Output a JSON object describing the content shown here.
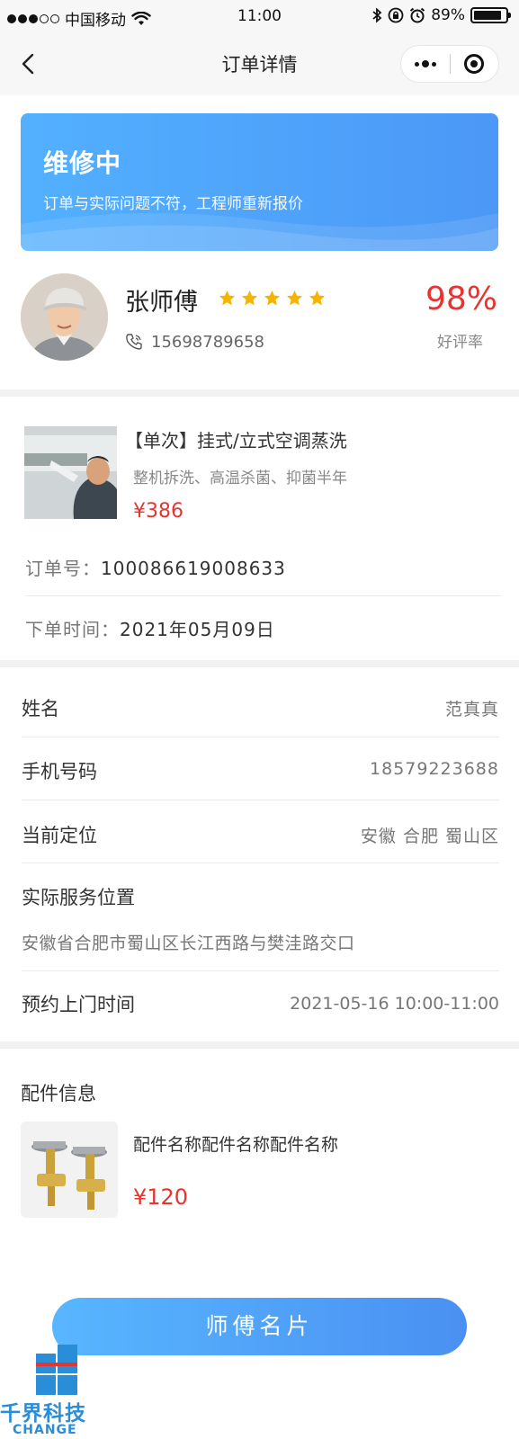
{
  "status_bar": {
    "carrier": "中国移动",
    "time": "11:00",
    "battery": "89%",
    "battery_level": 0.89
  },
  "nav": {
    "title": "订单详情",
    "back_icon": "chevron-left-icon",
    "more_icon": "more-dots-icon",
    "close_icon": "target-close-icon"
  },
  "status_card": {
    "title": "维修中",
    "description": "订单与实际问题不符，工程师重新报价"
  },
  "worker": {
    "name": "张师傅",
    "rating_stars": 5,
    "phone": "15698789658",
    "rate_value": "98%",
    "rate_label": "好评率"
  },
  "service": {
    "title": "【单次】挂式/立式空调蒸洗",
    "subtitle": "整机拆洗、高温杀菌、抑菌半年",
    "price": "¥386"
  },
  "order": {
    "number_label": "订单号：",
    "number": "100086619008633",
    "time_label": "下单时间：",
    "time": "2021年05月09日"
  },
  "customer": {
    "name_label": "姓名",
    "name": "范真真",
    "phone_label": "手机号码",
    "phone": "18579223688",
    "location_label": "当前定位",
    "location": "安徽 合肥 蜀山区",
    "address_label": "实际服务位置",
    "address": "安徽省合肥市蜀山区长江西路与樊洼路交口",
    "appointment_label": "预约上门时间",
    "appointment": "2021-05-16 10:00-11:00"
  },
  "parts": {
    "title": "配件信息",
    "name": "配件名称配件名称配件名称",
    "price": "¥120"
  },
  "button": {
    "label": "师傅名片"
  },
  "watermark": {
    "text": "千界科技",
    "sub": "CHANGE"
  },
  "colors": {
    "accent": "#4b98f6",
    "price_red": "#e8332f",
    "star": "#f5b400"
  }
}
